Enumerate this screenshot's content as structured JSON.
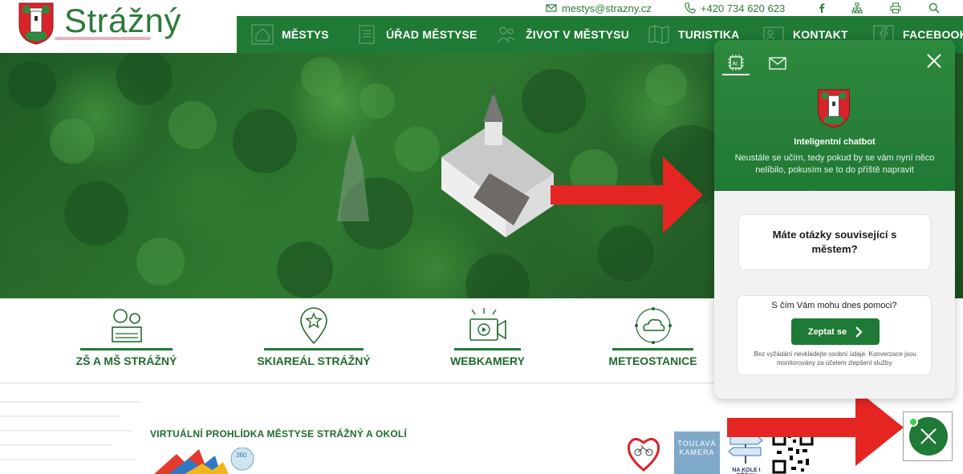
{
  "site": {
    "name": "Strážný"
  },
  "topbar": {
    "email": "mestys@strazny.cz",
    "phone": "+420 734 620 623",
    "icons": [
      "facebook-icon",
      "sitemap-icon",
      "print-icon",
      "search-icon"
    ]
  },
  "nav": {
    "items": [
      {
        "label": "MĚSTYS",
        "icon": "home-icon"
      },
      {
        "label": "ÚŘAD MĚSTYSE",
        "icon": "document-icon"
      },
      {
        "label": "ŽIVOT V MĚSTYSU",
        "icon": "people-icon"
      },
      {
        "label": "TURISTIKA",
        "icon": "map-icon"
      },
      {
        "label": "KONTAKT",
        "icon": "contact-icon"
      },
      {
        "label": "FACEBOOK",
        "icon": "facebook-icon"
      }
    ]
  },
  "quick_links": [
    {
      "label": "ZŠ A MŠ STRÁŽNÝ",
      "icon": "school-icon"
    },
    {
      "label": "SKIAREÁL STRÁŽNÝ",
      "icon": "map-pin-star-icon"
    },
    {
      "label": "WEBKAMERY",
      "icon": "camera-icon"
    },
    {
      "label": "METEOSTANICE",
      "icon": "cloud-icon"
    }
  ],
  "virtual_tour": {
    "title": "VIRTUÁLNÍ PROHLÍDKA MĚSTYSE STRÁŽNÝ A OKOLÍ"
  },
  "partners": {
    "toulava_kamera": "TOULAVÁ KAMERA",
    "na_kole_pesky": "NA KOLE I PĚŠKY"
  },
  "chatbot": {
    "title": "Inteligentní chatbot",
    "subtitle": "Neustále se učím, tedy pokud by se vám nyní něco nelíbilo, pokusím se to do příště napravit",
    "question_card": "Máte otázky související s městem?",
    "ask_prompt": "S čím Vám mohu dnes pomoci?",
    "ask_button": "Zeptat se",
    "note": "Bez vyžádání nevkládejte osobní údaje. Konverzace jsou monitorovány za účelem zlepšení služby.",
    "ai_badge": "AI"
  },
  "colors": {
    "brand_green": "#1f7a35",
    "accent_red": "#e52521",
    "status_dot": "#3bd14a"
  }
}
